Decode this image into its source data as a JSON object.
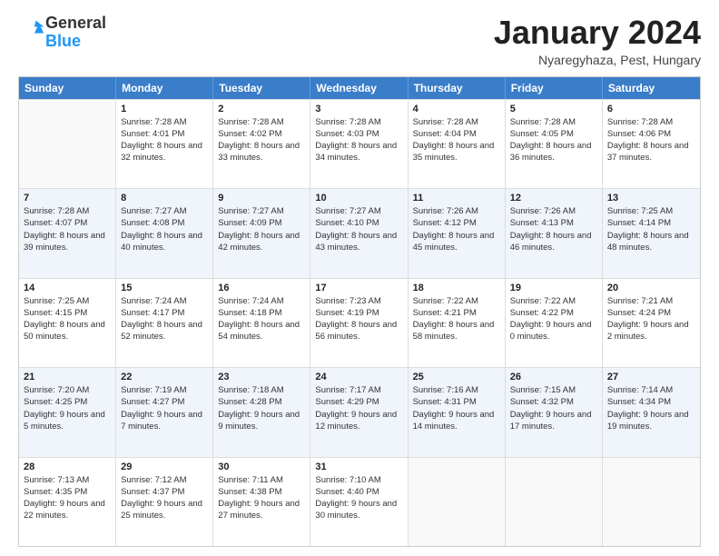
{
  "header": {
    "logo_general": "General",
    "logo_blue": "Blue",
    "month_title": "January 2024",
    "location": "Nyaregyhaza, Pest, Hungary"
  },
  "weekdays": [
    "Sunday",
    "Monday",
    "Tuesday",
    "Wednesday",
    "Thursday",
    "Friday",
    "Saturday"
  ],
  "weeks": [
    [
      {
        "day": "",
        "sunrise": "",
        "sunset": "",
        "daylight": ""
      },
      {
        "day": "1",
        "sunrise": "Sunrise: 7:28 AM",
        "sunset": "Sunset: 4:01 PM",
        "daylight": "Daylight: 8 hours and 32 minutes."
      },
      {
        "day": "2",
        "sunrise": "Sunrise: 7:28 AM",
        "sunset": "Sunset: 4:02 PM",
        "daylight": "Daylight: 8 hours and 33 minutes."
      },
      {
        "day": "3",
        "sunrise": "Sunrise: 7:28 AM",
        "sunset": "Sunset: 4:03 PM",
        "daylight": "Daylight: 8 hours and 34 minutes."
      },
      {
        "day": "4",
        "sunrise": "Sunrise: 7:28 AM",
        "sunset": "Sunset: 4:04 PM",
        "daylight": "Daylight: 8 hours and 35 minutes."
      },
      {
        "day": "5",
        "sunrise": "Sunrise: 7:28 AM",
        "sunset": "Sunset: 4:05 PM",
        "daylight": "Daylight: 8 hours and 36 minutes."
      },
      {
        "day": "6",
        "sunrise": "Sunrise: 7:28 AM",
        "sunset": "Sunset: 4:06 PM",
        "daylight": "Daylight: 8 hours and 37 minutes."
      }
    ],
    [
      {
        "day": "7",
        "sunrise": "Sunrise: 7:28 AM",
        "sunset": "Sunset: 4:07 PM",
        "daylight": "Daylight: 8 hours and 39 minutes."
      },
      {
        "day": "8",
        "sunrise": "Sunrise: 7:27 AM",
        "sunset": "Sunset: 4:08 PM",
        "daylight": "Daylight: 8 hours and 40 minutes."
      },
      {
        "day": "9",
        "sunrise": "Sunrise: 7:27 AM",
        "sunset": "Sunset: 4:09 PM",
        "daylight": "Daylight: 8 hours and 42 minutes."
      },
      {
        "day": "10",
        "sunrise": "Sunrise: 7:27 AM",
        "sunset": "Sunset: 4:10 PM",
        "daylight": "Daylight: 8 hours and 43 minutes."
      },
      {
        "day": "11",
        "sunrise": "Sunrise: 7:26 AM",
        "sunset": "Sunset: 4:12 PM",
        "daylight": "Daylight: 8 hours and 45 minutes."
      },
      {
        "day": "12",
        "sunrise": "Sunrise: 7:26 AM",
        "sunset": "Sunset: 4:13 PM",
        "daylight": "Daylight: 8 hours and 46 minutes."
      },
      {
        "day": "13",
        "sunrise": "Sunrise: 7:25 AM",
        "sunset": "Sunset: 4:14 PM",
        "daylight": "Daylight: 8 hours and 48 minutes."
      }
    ],
    [
      {
        "day": "14",
        "sunrise": "Sunrise: 7:25 AM",
        "sunset": "Sunset: 4:15 PM",
        "daylight": "Daylight: 8 hours and 50 minutes."
      },
      {
        "day": "15",
        "sunrise": "Sunrise: 7:24 AM",
        "sunset": "Sunset: 4:17 PM",
        "daylight": "Daylight: 8 hours and 52 minutes."
      },
      {
        "day": "16",
        "sunrise": "Sunrise: 7:24 AM",
        "sunset": "Sunset: 4:18 PM",
        "daylight": "Daylight: 8 hours and 54 minutes."
      },
      {
        "day": "17",
        "sunrise": "Sunrise: 7:23 AM",
        "sunset": "Sunset: 4:19 PM",
        "daylight": "Daylight: 8 hours and 56 minutes."
      },
      {
        "day": "18",
        "sunrise": "Sunrise: 7:22 AM",
        "sunset": "Sunset: 4:21 PM",
        "daylight": "Daylight: 8 hours and 58 minutes."
      },
      {
        "day": "19",
        "sunrise": "Sunrise: 7:22 AM",
        "sunset": "Sunset: 4:22 PM",
        "daylight": "Daylight: 9 hours and 0 minutes."
      },
      {
        "day": "20",
        "sunrise": "Sunrise: 7:21 AM",
        "sunset": "Sunset: 4:24 PM",
        "daylight": "Daylight: 9 hours and 2 minutes."
      }
    ],
    [
      {
        "day": "21",
        "sunrise": "Sunrise: 7:20 AM",
        "sunset": "Sunset: 4:25 PM",
        "daylight": "Daylight: 9 hours and 5 minutes."
      },
      {
        "day": "22",
        "sunrise": "Sunrise: 7:19 AM",
        "sunset": "Sunset: 4:27 PM",
        "daylight": "Daylight: 9 hours and 7 minutes."
      },
      {
        "day": "23",
        "sunrise": "Sunrise: 7:18 AM",
        "sunset": "Sunset: 4:28 PM",
        "daylight": "Daylight: 9 hours and 9 minutes."
      },
      {
        "day": "24",
        "sunrise": "Sunrise: 7:17 AM",
        "sunset": "Sunset: 4:29 PM",
        "daylight": "Daylight: 9 hours and 12 minutes."
      },
      {
        "day": "25",
        "sunrise": "Sunrise: 7:16 AM",
        "sunset": "Sunset: 4:31 PM",
        "daylight": "Daylight: 9 hours and 14 minutes."
      },
      {
        "day": "26",
        "sunrise": "Sunrise: 7:15 AM",
        "sunset": "Sunset: 4:32 PM",
        "daylight": "Daylight: 9 hours and 17 minutes."
      },
      {
        "day": "27",
        "sunrise": "Sunrise: 7:14 AM",
        "sunset": "Sunset: 4:34 PM",
        "daylight": "Daylight: 9 hours and 19 minutes."
      }
    ],
    [
      {
        "day": "28",
        "sunrise": "Sunrise: 7:13 AM",
        "sunset": "Sunset: 4:35 PM",
        "daylight": "Daylight: 9 hours and 22 minutes."
      },
      {
        "day": "29",
        "sunrise": "Sunrise: 7:12 AM",
        "sunset": "Sunset: 4:37 PM",
        "daylight": "Daylight: 9 hours and 25 minutes."
      },
      {
        "day": "30",
        "sunrise": "Sunrise: 7:11 AM",
        "sunset": "Sunset: 4:38 PM",
        "daylight": "Daylight: 9 hours and 27 minutes."
      },
      {
        "day": "31",
        "sunrise": "Sunrise: 7:10 AM",
        "sunset": "Sunset: 4:40 PM",
        "daylight": "Daylight: 9 hours and 30 minutes."
      },
      {
        "day": "",
        "sunrise": "",
        "sunset": "",
        "daylight": ""
      },
      {
        "day": "",
        "sunrise": "",
        "sunset": "",
        "daylight": ""
      },
      {
        "day": "",
        "sunrise": "",
        "sunset": "",
        "daylight": ""
      }
    ]
  ]
}
